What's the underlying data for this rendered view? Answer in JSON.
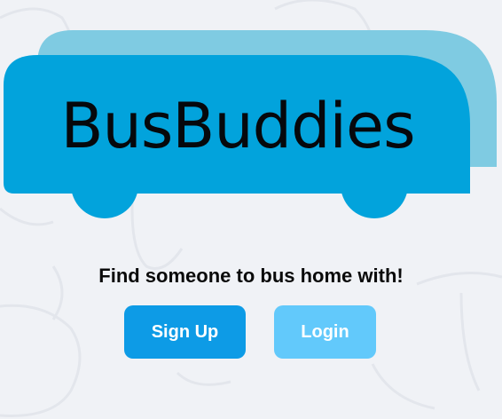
{
  "brand": {
    "name": "BusBuddies"
  },
  "hero": {
    "tagline": "Find someone to bus home with!"
  },
  "actions": {
    "signup_label": "Sign Up",
    "login_label": "Login"
  },
  "colors": {
    "background": "#f0f2f6",
    "bus_front": "#02a3dc",
    "bus_back": "#7fcbe2",
    "signup_button": "#0d9be6",
    "login_button": "#62c9fb",
    "text": "#06080c"
  }
}
